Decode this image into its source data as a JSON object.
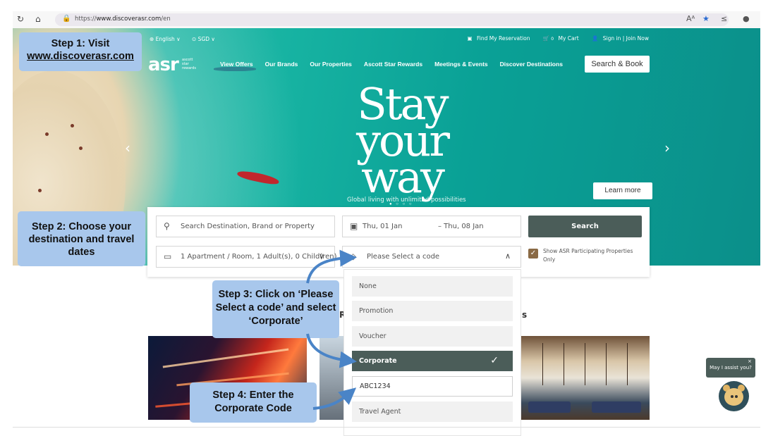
{
  "browser": {
    "url_prefix": "https://",
    "url_host": "www.discoverasr.com",
    "url_path": "/en",
    "icons": [
      "refresh-icon",
      "home-icon",
      "lock-icon",
      "read-aloud-icon",
      "star-icon",
      "favorites-icon",
      "profile-icon"
    ]
  },
  "header": {
    "language": "⊕ English ∨",
    "currency": "⊙ SGD ∨",
    "find_reservation": "Find My Reservation",
    "cart": "My Cart",
    "cart_count": "0",
    "sign_in": "Sign in | Join Now",
    "logo": "asr",
    "logo_sub": [
      "ascott",
      "star",
      "rewards"
    ],
    "nav": [
      "View Offers",
      "Our Brands",
      "Our Properties",
      "Ascott Star Rewards",
      "Meetings & Events",
      "Discover Destinations"
    ],
    "search_book": "Search & Book"
  },
  "hero": {
    "headline_lines": [
      "Stay",
      "your",
      "way"
    ],
    "tagline": "Global living with unlimited possibilities",
    "learn_more": "Learn more"
  },
  "booking": {
    "destination_placeholder": "Search Destination, Brand or Property",
    "checkin": "Thu, 01 Jan",
    "checkout": "– Thu, 08 Jan",
    "search_label": "Search",
    "rooms_guests": "1 Apartment / Room, 1 Adult(s), 0 Child(ren)",
    "code_placeholder": "Please Select a code",
    "asr_only": "Show ASR Participating Properties Only"
  },
  "code_dropdown": {
    "options": [
      "None",
      "Promotion",
      "Voucher",
      "Corporate"
    ],
    "selected": "Corporate",
    "code_value": "ABC1234",
    "after": "Travel Agent"
  },
  "section_letters": [
    "R",
    "s"
  ],
  "steps": {
    "step1_line1": "Step 1: Visit",
    "step1_line2": "www.discoverasr.com",
    "step2": "Step 2: Choose your destination and travel dates",
    "step3": "Step 3: Click on ‘Please Select a code’ and select ‘Corporate’",
    "step4": "Step 4: Enter the Corporate Code"
  },
  "chat": {
    "prompt": "May I assist you?"
  },
  "colors": {
    "accent": "#4b5d59",
    "callout": "#a8c7ec",
    "hero_teal": "#17b3a2",
    "checkbox": "#8a6a45"
  }
}
